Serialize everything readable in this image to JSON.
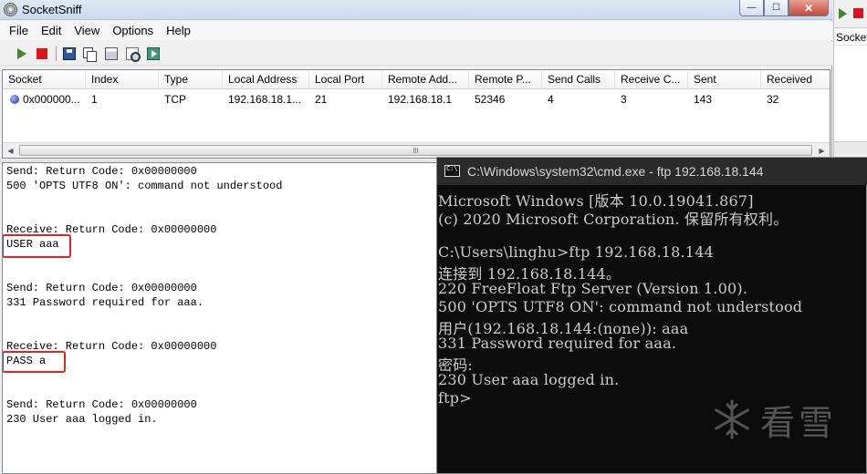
{
  "app": {
    "title": "SocketSniff",
    "window_buttons": {
      "minimize": "—",
      "maximize": "☐",
      "close": "✕"
    }
  },
  "menu": [
    "File",
    "Edit",
    "View",
    "Options",
    "Help"
  ],
  "toolbar": {
    "icons": [
      "start-capture-icon",
      "stop-capture-icon",
      "save-icon",
      "copy-icon",
      "properties-icon",
      "find-icon",
      "exit-icon"
    ]
  },
  "table": {
    "columns": [
      "Socket",
      "Index",
      "Type",
      "Local Address",
      "Local Port",
      "Remote Add...",
      "Remote P...",
      "Send Calls",
      "Receive C...",
      "Sent",
      "Received"
    ],
    "rows": [
      [
        "0x000000...",
        "1",
        "TCP",
        "192.168.18.1...",
        "21",
        "192.168.18.1",
        "52346",
        "4",
        "3",
        "143",
        "32"
      ]
    ],
    "scrollbar_grip": "III"
  },
  "log": [
    "Send: Return Code: 0x00000000",
    "500 'OPTS UTF8 ON': command not understood",
    "",
    "",
    "Receive: Return Code: 0x00000000",
    "USER aaa",
    "",
    "",
    "Send: Return Code: 0x00000000",
    "331 Password required for aaa.",
    "",
    "",
    "Receive: Return Code: 0x00000000",
    "PASS a",
    "",
    "",
    "Send: Return Code: 0x00000000",
    "230 User aaa logged in."
  ],
  "right_window": {
    "header": "Socket"
  },
  "cmd": {
    "title": "C:\\Windows\\system32\\cmd.exe - ftp  192.168.18.144",
    "lines": [
      "Microsoft Windows [版本 10.0.19041.867]",
      "(c) 2020 Microsoft Corporation. 保留所有权利。",
      "",
      "C:\\Users\\linghu>ftp 192.168.18.144",
      "连接到 192.168.18.144。",
      "220 FreeFloat Ftp Server (Version 1.00).",
      "500 'OPTS UTF8 ON': command not understood",
      "用户(192.168.18.144:(none)): aaa",
      "331 Password required for aaa.",
      "密码:",
      "230 User aaa logged in.",
      "ftp>"
    ]
  },
  "watermark": {
    "text": "看雪"
  }
}
